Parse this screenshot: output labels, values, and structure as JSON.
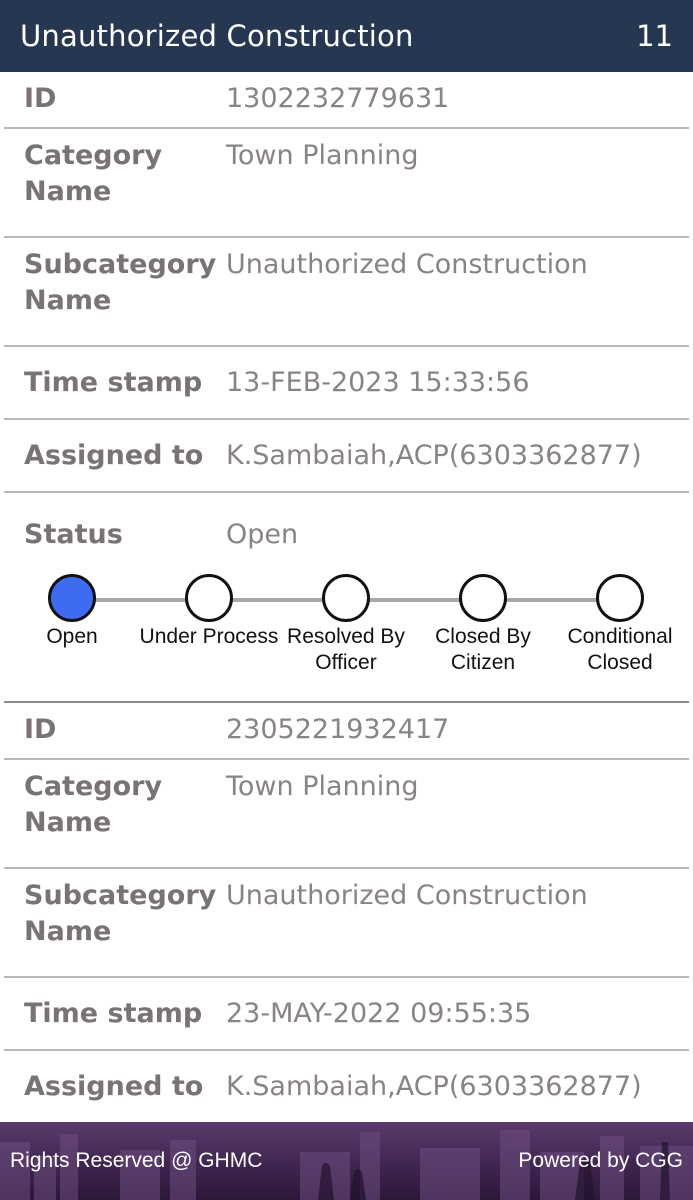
{
  "header": {
    "title": "Unauthorized Construction",
    "count": "11"
  },
  "complaints": [
    {
      "id_label": "ID",
      "id_value": "1302232779631",
      "category_label": "Category Name",
      "category_value": "Town Planning",
      "subcategory_label": "Subcategory Name",
      "subcategory_value": "Unauthorized Construction",
      "timestamp_label": "Time stamp",
      "timestamp_value": "13-FEB-2023 15:33:56",
      "assigned_label": "Assigned to",
      "assigned_value": "K.Sambaiah,ACP(6303362877)",
      "status_label": "Status",
      "status_value": "Open"
    },
    {
      "id_label": "ID",
      "id_value": "2305221932417",
      "category_label": "Category Name",
      "category_value": "Town Planning",
      "subcategory_label": "Subcategory Name",
      "subcategory_value": "Unauthorized Construction",
      "timestamp_label": "Time stamp",
      "timestamp_value": "23-MAY-2022 09:55:35",
      "assigned_label": "Assigned to",
      "assigned_value": "K.Sambaiah,ACP(6303362877)"
    }
  ],
  "stepper": {
    "steps": [
      "Open",
      "Under Process",
      "Resolved By Officer",
      "Closed By Citizen",
      "Conditional Closed"
    ],
    "active_index": 0,
    "active_color": "#3d6cf2"
  },
  "footer": {
    "left": "Rights Reserved @ GHMC",
    "right": "Powered by CGG"
  },
  "colors": {
    "header_bg": "#263851",
    "footer_bg": "#3f2650"
  }
}
